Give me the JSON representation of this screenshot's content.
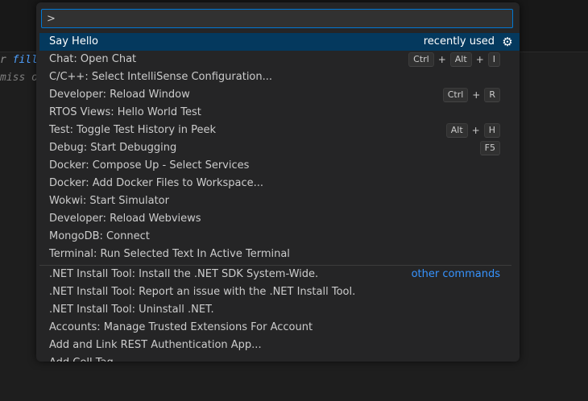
{
  "editor": {
    "line1_prefix": "r ",
    "line1_keyword": "fill",
    "line2": "miss or"
  },
  "quick_pick": {
    "input_value": ">",
    "selected_index": 0,
    "items": [
      {
        "label": "Say Hello",
        "detail": "recently used",
        "icon": "gear-icon"
      },
      {
        "label": "Chat: Open Chat",
        "keys": [
          "Ctrl",
          "Alt",
          "I"
        ]
      },
      {
        "label": "C/C++: Select IntelliSense Configuration..."
      },
      {
        "label": "Developer: Reload Window",
        "keys": [
          "Ctrl",
          "R"
        ]
      },
      {
        "label": "RTOS Views: Hello World Test"
      },
      {
        "label": "Test: Toggle Test History in Peek",
        "keys": [
          "Alt",
          "H"
        ]
      },
      {
        "label": "Debug: Start Debugging",
        "keys": [
          "F5"
        ]
      },
      {
        "label": "Docker: Compose Up - Select Services"
      },
      {
        "label": "Docker: Add Docker Files to Workspace..."
      },
      {
        "label": "Wokwi: Start Simulator"
      },
      {
        "label": "Developer: Reload Webviews"
      },
      {
        "label": "MongoDB: Connect"
      },
      {
        "label": "Terminal: Run Selected Text In Active Terminal"
      },
      {
        "label": ".NET Install Tool: Install the .NET SDK System-Wide.",
        "detail": "other commands",
        "separator_before": true
      },
      {
        "label": ".NET Install Tool: Report an issue with the .NET Install Tool."
      },
      {
        "label": ".NET Install Tool: Uninstall .NET."
      },
      {
        "label": "Accounts: Manage Trusted Extensions For Account"
      },
      {
        "label": "Add and Link REST Authentication App..."
      },
      {
        "label": "Add Cell Tag"
      }
    ],
    "plus_sign": "+",
    "gear_glyph": "⚙"
  }
}
